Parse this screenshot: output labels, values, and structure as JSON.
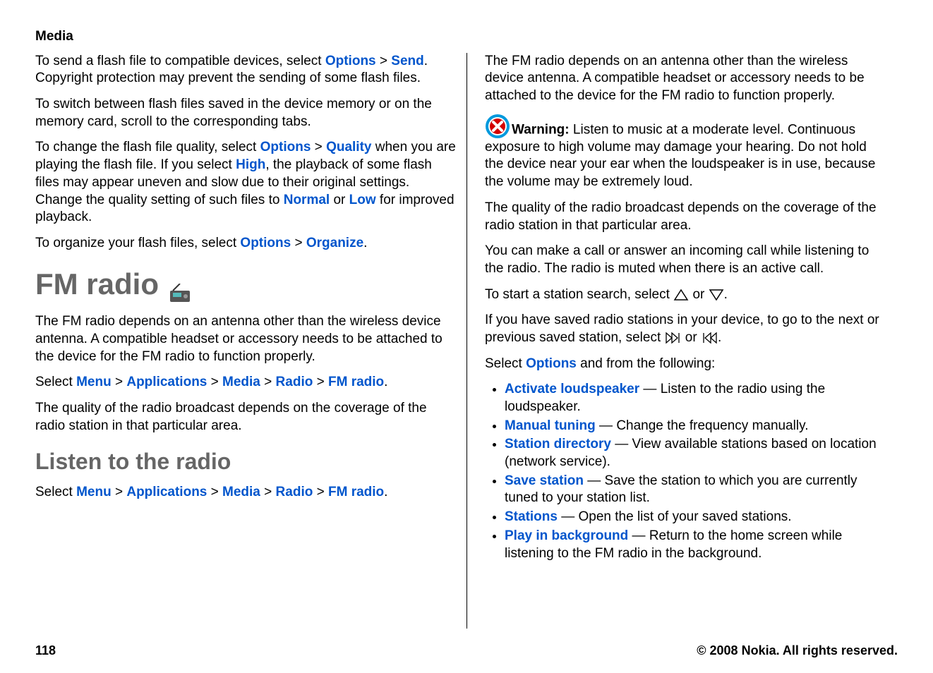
{
  "header": "Media",
  "left": {
    "p1_a": "To send a flash file to compatible devices, select ",
    "p1_opt": "Options",
    "p1_gt": " > ",
    "p1_send": "Send",
    "p1_b": ". Copyright protection may prevent the sending of some flash files.",
    "p2": "To switch between flash files saved in the device memory or on the memory card, scroll to the corresponding tabs.",
    "p3_a": "To change the flash file quality, select ",
    "p3_opt": "Options",
    "p3_gt": " > ",
    "p3_qual": "Quality",
    "p3_b": " when you are playing the flash file. If you select ",
    "p3_high": "High",
    "p3_c": ", the playback of some flash files may appear uneven and slow due to their original settings. Change the quality setting of such files to ",
    "p3_normal": "Normal",
    "p3_or": " or ",
    "p3_low": "Low",
    "p3_d": " for improved playback.",
    "p4_a": "To organize your flash files, select ",
    "p4_opt": "Options",
    "p4_gt": " > ",
    "p4_org": "Organize",
    "p4_b": ".",
    "h1": "FM radio",
    "p5": "The FM radio depends on an antenna other than the wireless device antenna. A compatible headset or accessory needs to be attached to the device for the FM radio to function properly.",
    "p6_a": "Select ",
    "p6_menu": "Menu",
    "p6_gt": " > ",
    "p6_apps": "Applications",
    "p6_media": "Media",
    "p6_radio": "Radio",
    "p6_fm": "FM radio",
    "p6_b": ".",
    "p7": "The quality of the radio broadcast depends on the coverage of the radio station in that particular area.",
    "h2": "Listen to the radio",
    "p8_a": "Select ",
    "p8_menu": "Menu",
    "p8_gt": " > ",
    "p8_apps": "Applications",
    "p8_media": "Media",
    "p8_radio": "Radio",
    "p8_fm": "FM radio",
    "p8_b": "."
  },
  "right": {
    "p1": "The FM radio depends on an antenna other than the wireless device antenna. A compatible headset or accessory needs to be attached to the device for the FM radio to function properly.",
    "warn_label": "Warning:  ",
    "warn_text": "Listen to music at a moderate level. Continuous exposure to high volume may damage your hearing. Do not hold the device near your ear when the loudspeaker is in use, because the volume may be extremely loud.",
    "p3": "The quality of the radio broadcast depends on the coverage of the radio station in that particular area.",
    "p4": "You can make a call or answer an incoming call while listening to the radio. The radio is muted when there is an active call.",
    "p5_a": "To start a station search, select ",
    "p5_or": " or ",
    "p5_b": ".",
    "p6_a": "If you have saved radio stations in your device, to go to the next or previous saved station, select ",
    "p6_or": " or ",
    "p6_b": ".",
    "p7_a": "Select ",
    "p7_opt": "Options",
    "p7_b": " and from the following:",
    "opts": [
      {
        "term": "Activate loudspeaker",
        "desc": " — Listen to the radio using the loudspeaker."
      },
      {
        "term": "Manual tuning",
        "desc": " — Change the frequency manually."
      },
      {
        "term": "Station directory",
        "desc": " — View available stations based on location (network service)."
      },
      {
        "term": "Save station",
        "desc": " — Save the station to which you are currently tuned to your station list."
      },
      {
        "term": "Stations",
        "desc": " — Open the list of your saved stations."
      },
      {
        "term": "Play in background",
        "desc": " — Return to the home screen while listening to the FM radio in the background."
      }
    ]
  },
  "footer": {
    "page": "118",
    "copy": "© 2008 Nokia. All rights reserved."
  }
}
